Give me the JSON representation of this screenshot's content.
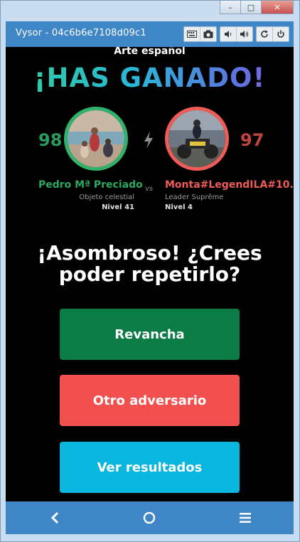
{
  "window": {
    "minimize_glyph": "–",
    "maximize_glyph": "□",
    "close_glyph": "✕"
  },
  "vysor": {
    "title": "Vysor - 04c6b6e7108d09c1",
    "tools": [
      "keyboard-icon",
      "camera-icon",
      "volume-down-icon",
      "volume-up-icon",
      "rotate-icon",
      "power-icon"
    ]
  },
  "game": {
    "category": "Arte español",
    "result": "¡HAS GANADO!",
    "player": {
      "score": "98",
      "name": "Pedro Mª Preciado",
      "title": "Objeto celestial",
      "level": "Nivel 41",
      "color": "#2fb36a"
    },
    "vs": "vs",
    "opponent": {
      "score": "97",
      "name": "Monta#LegendILA#10...",
      "title": "Leader Suprême",
      "level": "Nivel 4",
      "color": "#ef5b57"
    },
    "message_line1": "¡Asombroso! ¿Crees",
    "message_line2": "poder repetirlo?",
    "buttons": {
      "rematch": "Revancha",
      "new_opponent": "Otro adversario",
      "results": "Ver resultados"
    }
  },
  "navbar": {
    "icons": [
      "back-icon",
      "home-icon",
      "menu-icon"
    ]
  },
  "colors": {
    "vysor_blue": "#3f86c6",
    "rematch_green": "#0b7c45",
    "opponent_red": "#f2504f",
    "results_cyan": "#0ab5de"
  }
}
